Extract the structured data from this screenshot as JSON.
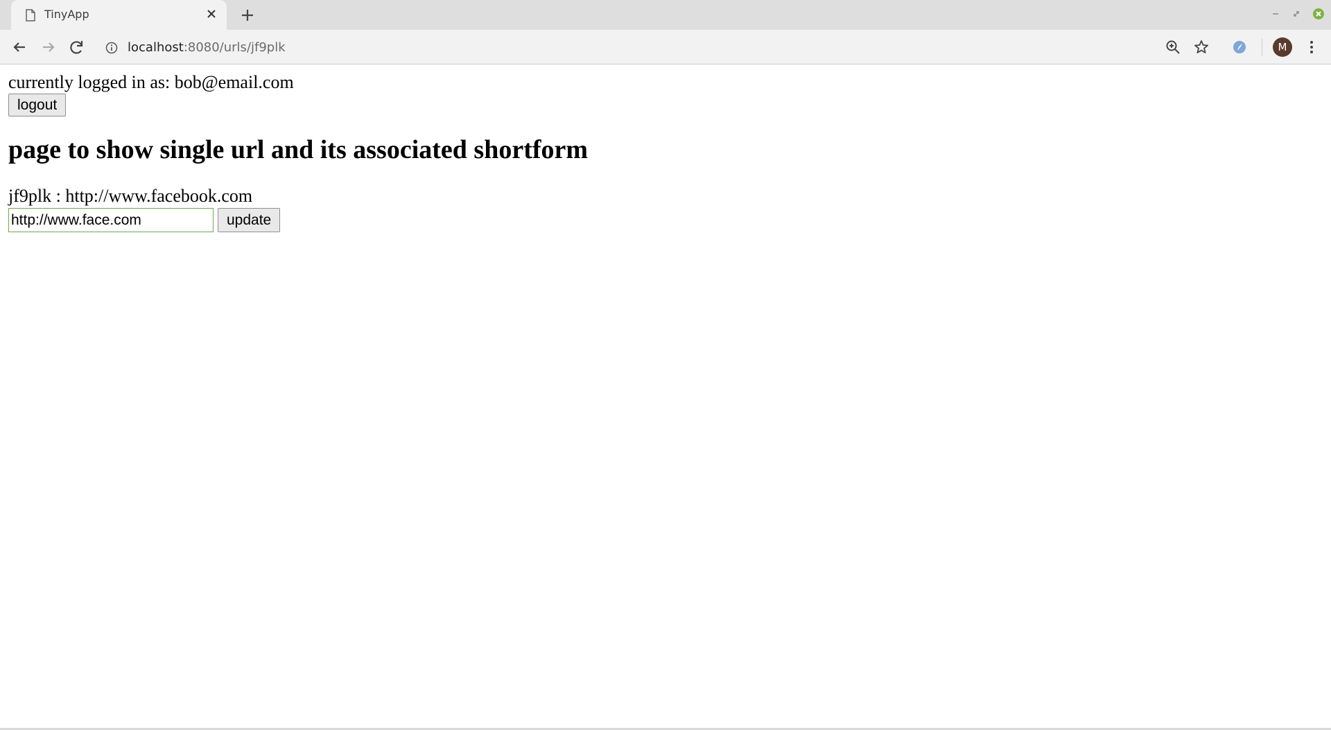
{
  "browser": {
    "tab_title": "TinyApp",
    "url_host": "localhost",
    "url_path": ":8080/urls/jf9plk",
    "profile_initial": "M"
  },
  "page": {
    "login_prefix": "currently logged in as: ",
    "login_email": "bob@email.com",
    "logout_label": "logout",
    "heading": "page to show single url and its associated shortform",
    "short_code": "jf9plk",
    "separator": " : ",
    "long_url": "http://www.facebook.com",
    "input_value": "http://www.face.com",
    "update_label": "update"
  },
  "colors": {
    "input_border": "#6aa84f",
    "avatar_bg": "#5b3a2e"
  }
}
